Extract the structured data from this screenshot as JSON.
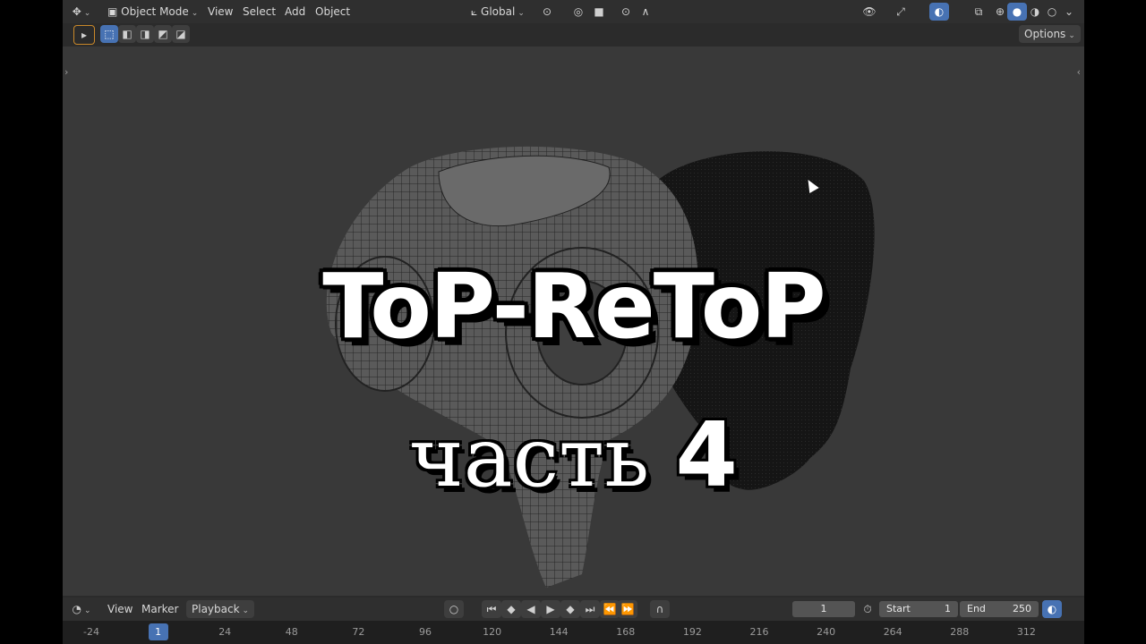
{
  "header": {
    "mode_label": "Object Mode",
    "menu": [
      "View",
      "Select",
      "Add",
      "Object"
    ],
    "transform_orientation": "Global",
    "options_label": "Options"
  },
  "overlay_text": {
    "line1": "ToP-ReToP",
    "line2_word": "часть",
    "line2_number": "4"
  },
  "timeline": {
    "menu": [
      "View",
      "Marker",
      "Playback"
    ],
    "current_frame": "1",
    "start_label": "Start",
    "start_value": "1",
    "end_label": "End",
    "end_value": "250",
    "ruler_ticks": [
      "-24",
      "1",
      "24",
      "48",
      "72",
      "96",
      "120",
      "144",
      "168",
      "192",
      "216",
      "240",
      "264",
      "288",
      "312"
    ]
  },
  "colors": {
    "accent": "#4772b3",
    "viewport_bg": "#393939",
    "header_bg": "#2f2f2f"
  }
}
